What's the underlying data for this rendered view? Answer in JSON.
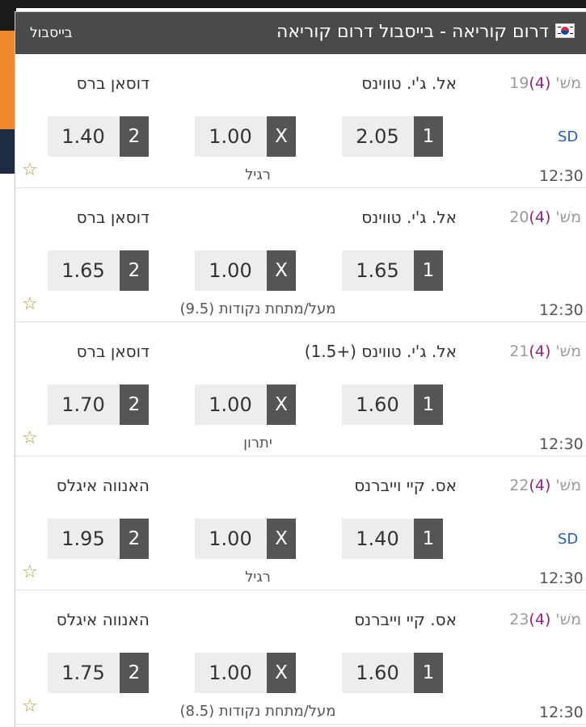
{
  "header": {
    "title": "דרום קוריאה - בייסבול דרום קוריאה",
    "sport": "בייסבול",
    "flag_icon": "south-korea-flag-icon"
  },
  "colors": {
    "header_bg": "#4a4a4a",
    "odd_bg": "#ededed",
    "odd_label_bg": "#555555",
    "level_color": "#8b2a7a",
    "sd_color": "#2c5fa3",
    "star_color": "#a99f3e"
  },
  "matches": [
    {
      "match_prefix": "משׁ' ",
      "number": "19",
      "level": "(4)",
      "home": "אל. ג'י. טווינס",
      "away": "דוסאן ברס",
      "odds": {
        "one": "2.05",
        "x": "1.00",
        "two": "1.40"
      },
      "labels": {
        "one": "1",
        "x": "X",
        "two": "2"
      },
      "sd": "SD",
      "bet_type": "רגיל",
      "time": "12:30"
    },
    {
      "match_prefix": "משׁ' ",
      "number": "20",
      "level": "(4)",
      "home": "אל. ג'י. טווינס",
      "away": "דוסאן ברס",
      "odds": {
        "one": "1.65",
        "x": "1.00",
        "two": "1.65"
      },
      "labels": {
        "one": "1",
        "x": "X",
        "two": "2"
      },
      "sd": "",
      "bet_type": "מעל/מתחת נקודות (9.5)",
      "time": "12:30"
    },
    {
      "match_prefix": "משׁ' ",
      "number": "21",
      "level": "(4)",
      "home": "אל. ג'י. טווינס (+1.5)",
      "away": "דוסאן ברס",
      "odds": {
        "one": "1.60",
        "x": "1.00",
        "two": "1.70"
      },
      "labels": {
        "one": "1",
        "x": "X",
        "two": "2"
      },
      "sd": "",
      "bet_type": "יתרון",
      "time": "12:30"
    },
    {
      "match_prefix": "משׁ' ",
      "number": "22",
      "level": "(4)",
      "home": "אס. קיי וייברנס",
      "away": "האנווה איגלס",
      "odds": {
        "one": "1.40",
        "x": "1.00",
        "two": "1.95"
      },
      "labels": {
        "one": "1",
        "x": "X",
        "two": "2"
      },
      "sd": "SD",
      "bet_type": "רגיל",
      "time": "12:30"
    },
    {
      "match_prefix": "משׁ' ",
      "number": "23",
      "level": "(4)",
      "home": "אס. קיי וייברנס",
      "away": "האנווה איגלס",
      "odds": {
        "one": "1.60",
        "x": "1.00",
        "two": "1.75"
      },
      "labels": {
        "one": "1",
        "x": "X",
        "two": "2"
      },
      "sd": "",
      "bet_type": "מעל/מתחת נקודות (8.5)",
      "time": "12:30"
    }
  ]
}
